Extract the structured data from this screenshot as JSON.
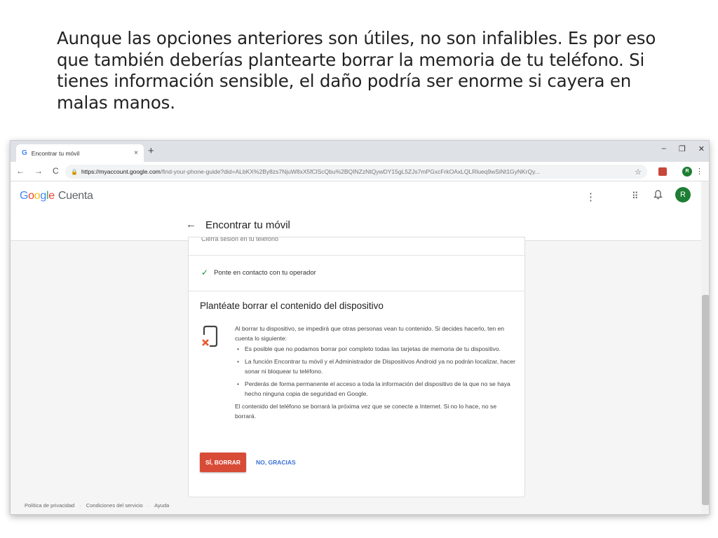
{
  "slide": {
    "caption": "Aunque las opciones anteriores son útiles, no son infalibles. Es por eso que también deberías plantearte borrar la memoria de tu teléfono. Si tienes información sensible, el daño podría ser enorme si cayera en malas manos."
  },
  "browser": {
    "tab_favicon": "G",
    "tab_title": "Encontrar tu móvil",
    "tab_close": "×",
    "new_tab": "+",
    "window_controls": [
      "–",
      "❐",
      "✕"
    ],
    "nav": [
      "←",
      "→",
      "C"
    ],
    "url_host": "https://myaccount.google.com",
    "url_rest": "/find-your-phone-guide?did=ALbKX%2By8zs7NjuW8xX5fClScQbu%2BQINZzNtQywDY15gL5ZJs7mPGxcFrkOAxLQLRlueq9wSiNt1GyNKrQy...",
    "star": "☆",
    "profile_initial": "R",
    "menu": "⋮"
  },
  "header": {
    "logo": [
      "G",
      "o",
      "o",
      "g",
      "l",
      "e"
    ],
    "product": "Cuenta",
    "more": "⋮",
    "apps": "⠿",
    "bell": "🔔",
    "avatar": "R"
  },
  "page": {
    "back": "←",
    "title": "Encontrar tu móvil"
  },
  "card": {
    "cut_row": "Cierra sesión en tu teléfono",
    "check_item": "Ponte en contacto con tu operador",
    "section_title": "Plantéate borrar el contenido del dispositivo",
    "intro": "Al borrar tu dispositivo, se impedirá que otras personas vean tu contenido. Si decides hacerlo, ten en cuenta lo siguiente:",
    "bullets": [
      "Es posible que no podamos borrar por completo todas las tarjetas de memoria de tu dispositivo.",
      "La función Encontrar tu móvil y el Administrador de Dispositivos Android ya no podrán localizar, hacer sonar ni bloquear tu teléfono.",
      "Perderás de forma permanente el acceso a toda la información del dispositivo de la que no se haya hecho ninguna copia de seguridad en Google."
    ],
    "outro": "El contenido del teléfono se borrará la próxima vez que se conecte a Internet. Si no lo hace, no se borrará.",
    "confirm_label": "SÍ, BORRAR",
    "cancel_label": "NO, GRACIAS"
  },
  "footer": {
    "links": [
      "Política de privacidad",
      "Condiciones del servicio",
      "Ayuda"
    ],
    "separator": "·"
  },
  "colors": {
    "confirm_button": "#d84b37",
    "link_blue": "#3b6fd8",
    "check_green": "#1e8e3e",
    "avatar_green": "#1e7e34",
    "warning_icon_orange": "#e8562b"
  }
}
